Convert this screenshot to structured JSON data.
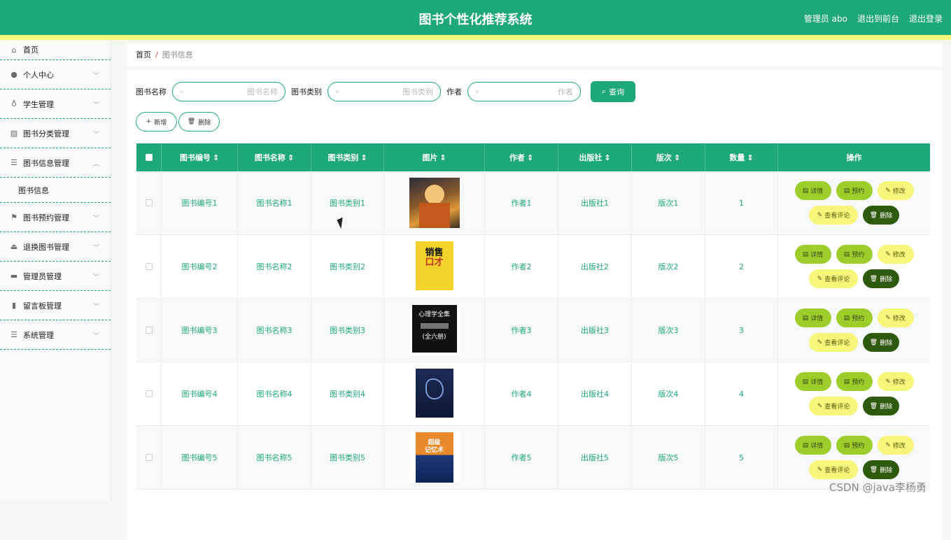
{
  "header": {
    "title": "图书个性化推荐系统",
    "admin": "管理员 abo",
    "front": "退出到前台",
    "logout": "退出登录"
  },
  "sidebar": {
    "items": [
      {
        "label": "首页",
        "icon": "home-icon"
      },
      {
        "label": "个人中心",
        "icon": "user-icon"
      },
      {
        "label": "学生管理",
        "icon": "mic-icon"
      },
      {
        "label": "图书分类管理",
        "icon": "chart-icon"
      },
      {
        "label": "图书信息管理",
        "icon": "list-icon"
      },
      {
        "label": "图书信息",
        "icon": ""
      },
      {
        "label": "图书预约管理",
        "icon": "flag-icon"
      },
      {
        "label": "退换图书管理",
        "icon": "stamp-icon"
      },
      {
        "label": "管理员管理",
        "icon": "monitor-icon"
      },
      {
        "label": "留言板管理",
        "icon": "bar-icon"
      },
      {
        "label": "系统管理",
        "icon": "list-icon"
      }
    ]
  },
  "breadcrumb": {
    "home": "首页",
    "sep": "/",
    "current": "图书信息"
  },
  "search": {
    "name_label": "图书名称",
    "name_placeholder": "图书名称",
    "type_label": "图书类别",
    "type_placeholder": "图书类别",
    "author_label": "作者",
    "author_placeholder": "作者",
    "query": "查询"
  },
  "actions": {
    "add": "新增",
    "delete": "删除"
  },
  "table": {
    "headers": [
      "图书编号",
      "图书名称",
      "图书类别",
      "图片",
      "作者",
      "出版社",
      "版次",
      "数量",
      "操作"
    ],
    "rows": [
      {
        "id": "图书编号1",
        "name": "图书名称1",
        "type": "图书类别1",
        "author": "作者1",
        "publisher": "出版社1",
        "edition": "版次1",
        "qty": "1"
      },
      {
        "id": "图书编号2",
        "name": "图书名称2",
        "type": "图书类别2",
        "author": "作者2",
        "publisher": "出版社2",
        "edition": "版次2",
        "qty": "2"
      },
      {
        "id": "图书编号3",
        "name": "图书名称3",
        "type": "图书类别3",
        "author": "作者3",
        "publisher": "出版社3",
        "edition": "版次3",
        "qty": "3"
      },
      {
        "id": "图书编号4",
        "name": "图书名称4",
        "type": "图书类别4",
        "author": "作者4",
        "publisher": "出版社4",
        "edition": "版次4",
        "qty": "4"
      },
      {
        "id": "图书编号5",
        "name": "图书名称5",
        "type": "图书类别5",
        "author": "作者5",
        "publisher": "出版社5",
        "edition": "版次5",
        "qty": "5"
      }
    ],
    "ops": {
      "detail": "详情",
      "reserve": "预约",
      "edit": "修改",
      "comments": "查看评论",
      "delete": "删除"
    },
    "covers": {
      "c2": [
        "销售",
        "口才"
      ],
      "c3": [
        "心理学全集",
        "(全六册)"
      ],
      "c5": [
        "超级",
        "记忆术"
      ]
    }
  },
  "watermark": "CSDN @java李杨勇",
  "colors": {
    "primary": "#1fa877",
    "stripe": "#f5f77a",
    "green_btn": "#9ccd2b",
    "yellow_btn": "#f6f77a",
    "dark_btn": "#2e5a0d"
  }
}
